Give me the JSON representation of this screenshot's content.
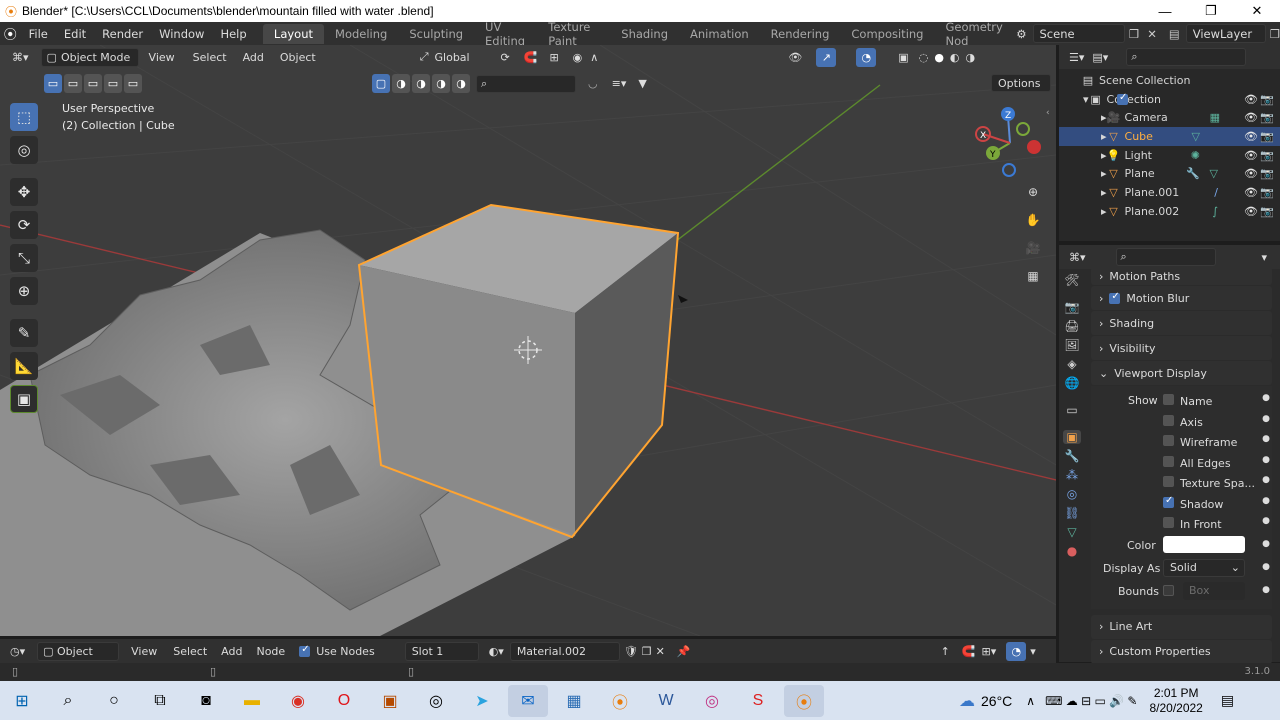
{
  "window": {
    "title": "Blender* [C:\\Users\\CCL\\Documents\\blender\\mountain filled with water .blend]"
  },
  "menu": [
    "File",
    "Edit",
    "Render",
    "Window",
    "Help"
  ],
  "workspaces": [
    "Layout",
    "Modeling",
    "Sculpting",
    "UV Editing",
    "Texture Paint",
    "Shading",
    "Animation",
    "Rendering",
    "Compositing",
    "Geometry Nod"
  ],
  "scene": "Scene",
  "view_layer": "ViewLayer",
  "viewport": {
    "mode": "Object Mode",
    "menus": [
      "View",
      "Select",
      "Add",
      "Object"
    ],
    "transform_orientation": "Global",
    "options_label": "Options",
    "overlay_title": "User Perspective",
    "overlay_subtitle": "(2) Collection | Cube",
    "gizmo_axes": [
      "X",
      "Y",
      "Z"
    ]
  },
  "outliner": {
    "root": "Scene Collection",
    "collection": "Collection",
    "items": [
      {
        "name": "Camera",
        "icon": "camera-icon",
        "selected": false
      },
      {
        "name": "Cube",
        "icon": "mesh-icon",
        "selected": true
      },
      {
        "name": "Light",
        "icon": "light-icon",
        "selected": false
      },
      {
        "name": "Plane",
        "icon": "mesh-icon",
        "selected": false
      },
      {
        "name": "Plane.001",
        "icon": "mesh-icon",
        "selected": false
      },
      {
        "name": "Plane.002",
        "icon": "mesh-icon",
        "selected": false
      }
    ]
  },
  "properties": {
    "sections_top": [
      "Motion Paths",
      "Motion Blur",
      "Shading",
      "Visibility",
      "Viewport Display"
    ],
    "show_label": "Show",
    "show_options": [
      {
        "label": "Name",
        "checked": false
      },
      {
        "label": "Axis",
        "checked": false
      },
      {
        "label": "Wireframe",
        "checked": false
      },
      {
        "label": "All Edges",
        "checked": false
      },
      {
        "label": "Texture Spa...",
        "checked": false
      },
      {
        "label": "Shadow",
        "checked": true
      },
      {
        "label": "In Front",
        "checked": false
      }
    ],
    "color_label": "Color",
    "display_as_label": "Display As",
    "display_as_value": "Solid",
    "bounds_label": "Bounds",
    "bounds_value": "Box",
    "sections_bottom": [
      "Line Art",
      "Custom Properties"
    ]
  },
  "shader_editor": {
    "type": "Object",
    "menus": [
      "View",
      "Select",
      "Add",
      "Node"
    ],
    "use_nodes_label": "Use Nodes",
    "use_nodes": true,
    "slot": "Slot 1",
    "material": "Material.002"
  },
  "status": {
    "version": "3.1.0"
  },
  "taskbar": {
    "weather": "26°C",
    "time": "2:01 PM",
    "date": "8/20/2022"
  },
  "colors": {
    "accent": "#4772b3",
    "selection_outline": "#ffa431",
    "viewport_bg": "#3d3d3d"
  }
}
